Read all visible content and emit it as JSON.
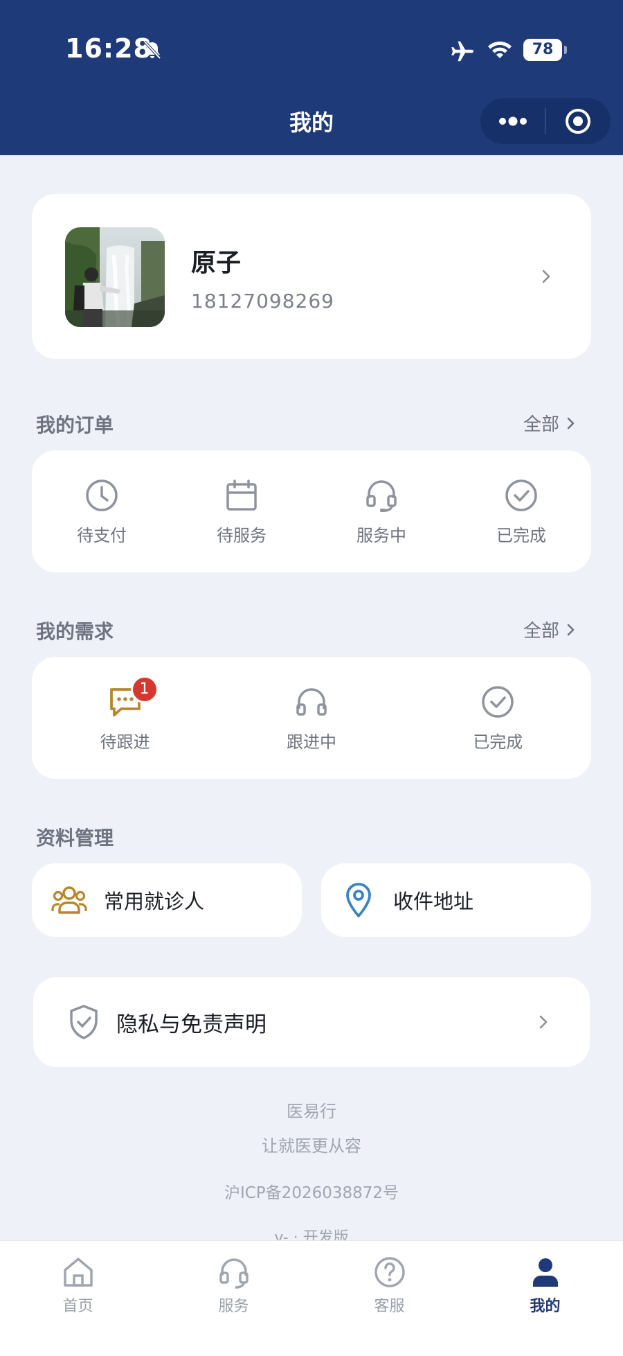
{
  "status_bar": {
    "time": "16:28",
    "battery": "78"
  },
  "header": {
    "title": "我的"
  },
  "profile": {
    "name": "原子",
    "phone": "18127098269"
  },
  "orders": {
    "title": "我的订单",
    "more": "全部",
    "items": [
      {
        "label": "待支付",
        "icon": "clock-icon"
      },
      {
        "label": "待服务",
        "icon": "calendar-icon"
      },
      {
        "label": "服务中",
        "icon": "headset-icon"
      },
      {
        "label": "已完成",
        "icon": "check-circle-icon"
      }
    ]
  },
  "requests": {
    "title": "我的需求",
    "more": "全部",
    "items": [
      {
        "label": "待跟进",
        "icon": "chat-icon",
        "badge": "1"
      },
      {
        "label": "跟进中",
        "icon": "headphones-icon"
      },
      {
        "label": "已完成",
        "icon": "check-circle-icon"
      }
    ]
  },
  "profile_mgmt": {
    "title": "资料管理",
    "patients": "常用就诊人",
    "address": "收件地址"
  },
  "privacy": {
    "label": "隐私与免责声明"
  },
  "footer": {
    "app_name": "医易行",
    "slogan": "让就医更从容",
    "icp": "沪ICP备2026038872号",
    "version": "v- · 开发版"
  },
  "tabs": [
    {
      "label": "首页",
      "icon": "home-icon"
    },
    {
      "label": "服务",
      "icon": "headset-icon"
    },
    {
      "label": "客服",
      "icon": "help-icon"
    },
    {
      "label": "我的",
      "icon": "user-icon",
      "active": true
    }
  ],
  "colors": {
    "primary": "#1f3a78",
    "accent_gold": "#b8862e",
    "badge_red": "#d4382f",
    "location_blue": "#3b82c4"
  }
}
